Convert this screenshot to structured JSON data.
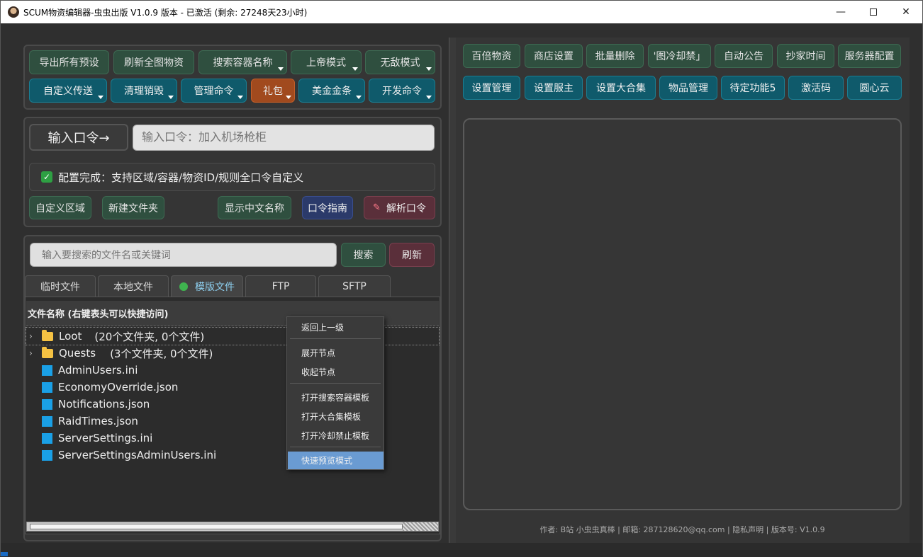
{
  "window": {
    "title": "SCUM物资编辑器-虫虫出版 V1.0.9 版本 - 已激活 (剩余: 27248天23小时)",
    "minimize": "—",
    "close": "✕"
  },
  "top_left_buttons": {
    "row1": [
      "导出所有预设",
      "刷新全图物资",
      "搜索容器名称",
      "上帝模式",
      "无敌模式"
    ],
    "row2": [
      "自定义传送",
      "清理销毁",
      "管理命令",
      "礼包",
      "美金金条",
      "开发命令"
    ]
  },
  "command": {
    "label": "输入口令→",
    "placeholder": "输入口令：加入机场枪柜"
  },
  "config": {
    "checked": true,
    "text": "配置完成：支持区域/容器/物资ID/规则全口令自定义"
  },
  "action_buttons": {
    "custom_region": "自定义区域",
    "new_folder": "新建文件夹",
    "show_chinese": "显示中文名称",
    "guide": "口令指南",
    "parse": "解析口令"
  },
  "search": {
    "placeholder": "输入要搜索的文件名或关键词",
    "search_label": "搜索",
    "refresh_label": "刷新"
  },
  "tabs": [
    "临时文件",
    "本地文件",
    "模版文件",
    "FTP",
    "SFTP"
  ],
  "active_tab": "模版文件",
  "file_list": {
    "header": "文件名称 (右键表头可以快捷访问)",
    "folders": [
      {
        "name": "Loot",
        "info": "(20个文件夹, 0个文件)"
      },
      {
        "name": "Quests",
        "info": "(3个文件夹, 0个文件)"
      }
    ],
    "files": [
      "AdminUsers.ini",
      "EconomyOverride.json",
      "Notifications.json",
      "RaidTimes.json",
      "ServerSettings.ini",
      "ServerSettingsAdminUsers.ini"
    ]
  },
  "context_menu": {
    "items": [
      "返回上一级",
      "展开节点",
      "收起节点",
      "打开搜索容器模板",
      "打开大合集模板",
      "打开冷却禁止模板",
      "快速预览模式"
    ],
    "highlighted": "快速预览模式"
  },
  "right_buttons": {
    "row1": [
      "百倍物资",
      "商店设置",
      "批量删除",
      "'图冷却禁」",
      "自动公告",
      "抄家时间",
      "服务器配置"
    ],
    "row2": [
      "设置管理",
      "设置服主",
      "设置大合集",
      "物品管理",
      "待定功能5",
      "激活码",
      "圆心云"
    ]
  },
  "footer": "作者: B站 小虫虫真棒 | 邮箱: 287128620@qq.com | 隐私声明 | 版本号: V1.0.9",
  "icons": {
    "checkbox": "check-icon",
    "parse": "pen-icon",
    "folder": "folder-icon",
    "file": "file-icon",
    "tab_dot": "status-dot-icon"
  },
  "colors": {
    "teal": "#0f5a6b",
    "green": "#2f4f3f",
    "orange": "#a14a1e",
    "highlight": "#6a9bd2"
  }
}
